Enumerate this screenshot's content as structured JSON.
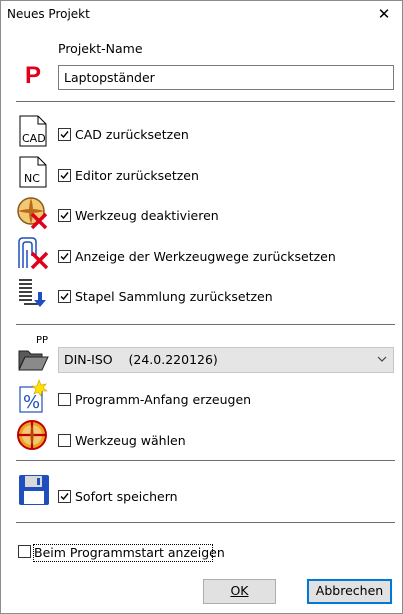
{
  "window": {
    "title": "Neues Projekt",
    "close_symbol": "✕"
  },
  "project": {
    "label": "Projekt-Name",
    "value": "Laptopständer",
    "icon_letter": "P"
  },
  "reset_options": [
    {
      "icon": "cad-file-icon",
      "icon_text": "CAD",
      "label": "CAD zurücksetzen",
      "checked": true
    },
    {
      "icon": "nc-file-icon",
      "icon_text": "NC",
      "label": "Editor zurücksetzen",
      "checked": true
    },
    {
      "icon": "tool-disable-icon",
      "label": "Werkzeug deaktivieren",
      "checked": true
    },
    {
      "icon": "toolpath-reset-icon",
      "label": "Anzeige der Werkzeugwege zurücksetzen",
      "checked": true
    },
    {
      "icon": "batch-reset-icon",
      "label": "Stapel Sammlung zurücksetzen",
      "checked": true
    }
  ],
  "postprocessor": {
    "icon_text": "PP",
    "selected": "DIN-ISO    (24.0.220126)"
  },
  "program_options": [
    {
      "icon": "program-start-icon",
      "icon_text": "%",
      "label": "Programm-Anfang erzeugen",
      "checked": false
    },
    {
      "icon": "tool-select-icon",
      "label": "Werkzeug wählen",
      "checked": false
    }
  ],
  "save": {
    "label": "Sofort speichern",
    "checked": true
  },
  "startup": {
    "label": "Beim Programmstart anzeigen",
    "checked": false
  },
  "buttons": {
    "ok": "OK",
    "cancel": "Abbrechen"
  },
  "colors": {
    "accent_red": "#e0001a",
    "accent_blue": "#0078d7",
    "button_bg": "#e1e1e1"
  }
}
